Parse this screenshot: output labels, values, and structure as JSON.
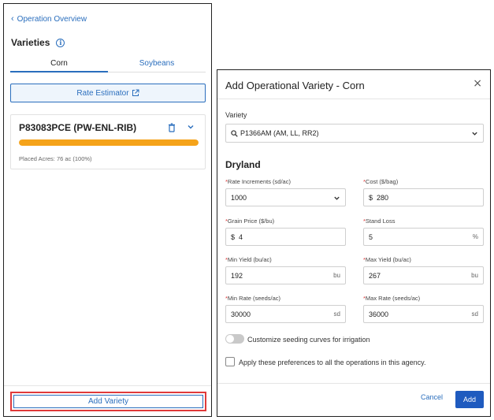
{
  "left": {
    "back_label": "Operation Overview",
    "section_title": "Varieties",
    "tabs": [
      {
        "label": "Corn",
        "active": true
      },
      {
        "label": "Soybeans",
        "active": false
      }
    ],
    "rate_estimator_label": "Rate Estimator",
    "variety_card": {
      "name": "P83083PCE (PW-ENL-RIB)",
      "placed_text": "Placed Acres: 76 ac (100%)",
      "progress_percent": 100,
      "progress_color": "#f5a31a"
    },
    "add_variety_label": "Add Variety"
  },
  "modal": {
    "title": "Add Operational Variety - Corn",
    "close_symbol": "×",
    "variety_label": "Variety",
    "variety_value": "P1366AM (AM, LL, RR2)",
    "section": "Dryland",
    "fields": {
      "rate_increments": {
        "label": "Rate Increments (sd/ac)",
        "value": "1000"
      },
      "cost": {
        "label": "Cost ($/bag)",
        "prefix": "$",
        "value": "280"
      },
      "grain_price": {
        "label": "Grain Price ($/bu)",
        "prefix": "$",
        "value": "4"
      },
      "stand_loss": {
        "label": "Stand Loss",
        "value": "5",
        "suffix": "%"
      },
      "min_yield": {
        "label": "Min Yield (bu/ac)",
        "value": "192",
        "suffix": "bu"
      },
      "max_yield": {
        "label": "Max Yield (bu/ac)",
        "value": "267",
        "suffix": "bu"
      },
      "min_rate": {
        "label": "Min Rate (seeds/ac)",
        "value": "30000",
        "suffix": "sd"
      },
      "max_rate": {
        "label": "Max Rate (seeds/ac)",
        "value": "36000",
        "suffix": "sd"
      }
    },
    "required_marker": "*",
    "toggle_label": "Customize seeding curves for irrigation",
    "checkbox_label": "Apply these preferences to all the operations in this agency.",
    "cancel_label": "Cancel",
    "add_label": "Add"
  },
  "colors": {
    "accent": "#2a6ebd",
    "primary_button": "#1f5bbf",
    "highlight_border": "#e03a3a",
    "required": "#d33333"
  }
}
